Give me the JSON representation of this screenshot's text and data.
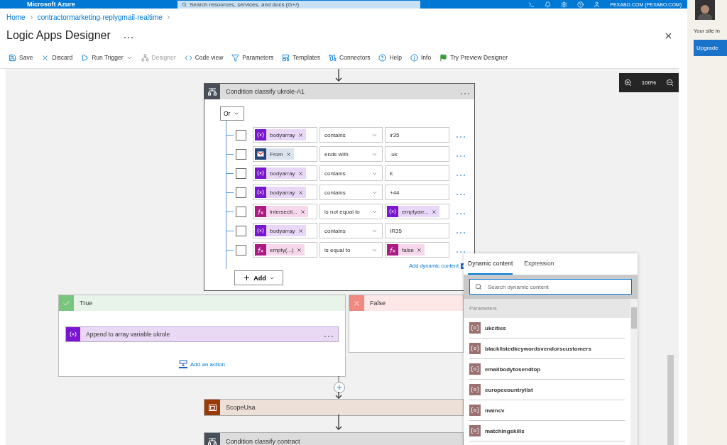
{
  "topbar": {
    "brand": "Microsoft Azure",
    "search_placeholder": "Search resources, services, and docs (G+/)",
    "account": "PEXABO.COM (PEXABO.COM)"
  },
  "breadcrumb": [
    "Home",
    "contractormarketing-replygmail-realtime"
  ],
  "title": "Logic Apps Designer",
  "toolbar": [
    {
      "kind": "save",
      "label": "Save",
      "disabled": false
    },
    {
      "kind": "discard",
      "label": "Discard",
      "disabled": false
    },
    {
      "kind": "run",
      "label": "Run Trigger",
      "disabled": false,
      "dropdown": true
    },
    {
      "kind": "designer",
      "label": "Designer",
      "disabled": true
    },
    {
      "kind": "code",
      "label": "Code view",
      "disabled": false
    },
    {
      "kind": "parameters",
      "label": "Parameters",
      "disabled": false
    },
    {
      "kind": "templates",
      "label": "Templates",
      "disabled": false
    },
    {
      "kind": "connectors",
      "label": "Connectors",
      "disabled": false
    },
    {
      "kind": "help",
      "label": "Help",
      "disabled": false
    },
    {
      "kind": "info",
      "label": "Info",
      "disabled": false
    },
    {
      "kind": "preview",
      "label": "Try Preview Designer",
      "disabled": false
    }
  ],
  "zoom": {
    "reading": "100%"
  },
  "condition": {
    "title": "Condition classify ukrole-A1",
    "group_operator": "Or",
    "rows": [
      {
        "checked": false,
        "left": {
          "kind": "variable",
          "text": "bodyarray"
        },
        "operator": "contains",
        "right": {
          "kind": "text",
          "text": "ir35"
        }
      },
      {
        "checked": false,
        "left": {
          "kind": "gmail",
          "text": "From"
        },
        "operator": "ends with",
        "right": {
          "kind": "text",
          "text": ".uk"
        }
      },
      {
        "checked": false,
        "left": {
          "kind": "variable",
          "text": "bodyarray"
        },
        "operator": "contains",
        "right": {
          "kind": "text",
          "text": "£"
        }
      },
      {
        "checked": false,
        "left": {
          "kind": "variable",
          "text": "bodyarray"
        },
        "operator": "contains",
        "right": {
          "kind": "text",
          "text": "+44"
        }
      },
      {
        "checked": false,
        "left": {
          "kind": "expression",
          "text": "intersecti..."
        },
        "operator": "is not equal to",
        "right": {
          "kind": "variable",
          "text": "emptyarr..."
        }
      },
      {
        "checked": false,
        "left": {
          "kind": "variable",
          "text": "bodyarray"
        },
        "operator": "contains",
        "right": {
          "kind": "text",
          "text": "IR35"
        }
      },
      {
        "checked": false,
        "left": {
          "kind": "expression",
          "text": "empty(...)"
        },
        "operator": "is equal to",
        "right": {
          "kind": "expression",
          "text": "false"
        }
      }
    ],
    "add_dynamic": "Add dynamic content",
    "add_button": "Add"
  },
  "branches": [
    {
      "kind": "true",
      "title": "True",
      "actions": [
        {
          "title": "Append to array variable ukrole"
        }
      ],
      "add_action": "Add an action"
    },
    {
      "kind": "false",
      "title": "False"
    }
  ],
  "steps": [
    {
      "kind": "scope",
      "title": "ScopeUsa"
    },
    {
      "kind": "condition",
      "title": "Condition classify contract"
    }
  ],
  "dynamic_panel": {
    "tabs": [
      {
        "label": "Dynamic content",
        "selected": true
      },
      {
        "label": "Expression",
        "selected": false
      }
    ],
    "search_placeholder": "Search dynamic content",
    "section": "Parameters",
    "items": [
      "ukcities",
      "blacklistedkeywordsvendorscustomers",
      "emailbodytosendtop",
      "europecountrylist",
      "maincv",
      "matchingskills"
    ]
  },
  "side": {
    "text": "Your site in",
    "button": "Upgrade"
  }
}
